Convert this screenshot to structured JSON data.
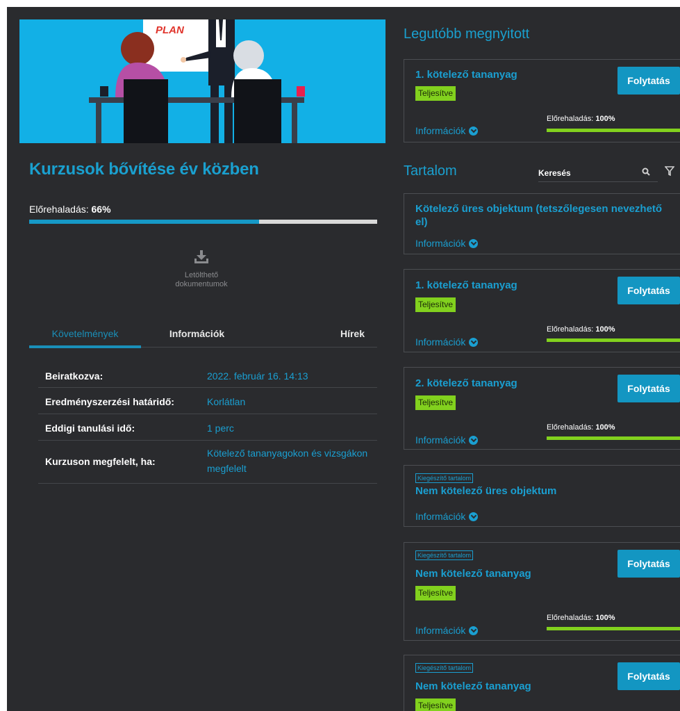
{
  "course": {
    "title": "Kurzusok bővítése év közben",
    "progress_label": "Előrehaladás:",
    "progress_value": "66%",
    "progress_fraction": 0.66,
    "banner_sign_text": "PLAN"
  },
  "downloads": {
    "label_line1": "Letölthető",
    "label_line2": "dokumentumok",
    "icon": "download-icon"
  },
  "tabs": [
    {
      "label": "Követelmények",
      "active": true
    },
    {
      "label": "Információk",
      "active": false
    },
    {
      "label": "Hírek",
      "active": false
    }
  ],
  "requirements": [
    {
      "label": "Beiratkozva:",
      "value": "2022. február 16. 14:13"
    },
    {
      "label": "Eredményszerzési határidő:",
      "value": "Korlátlan"
    },
    {
      "label": "Eddigi tanulási idő:",
      "value": "1 perc"
    },
    {
      "label": "Kurzuson megfelelt, ha:",
      "value": "Kötelező tananyagokon és vizsgákon megfelelt"
    }
  ],
  "recent": {
    "heading": "Legutóbb megnyitott",
    "card": {
      "title": "1. kötelező tananyag",
      "status": "Teljesítve",
      "button": "Folytatás",
      "progress_label": "Előrehaladás:",
      "progress_value": "100%",
      "info": "Információk"
    }
  },
  "content": {
    "heading": "Tartalom",
    "search_placeholder": "Keresés",
    "items": [
      {
        "title": "Kötelező üres objektum (tetszőlegesen nevezhető el)",
        "info": "Információk"
      },
      {
        "title": "1. kötelező tananyag",
        "status": "Teljesítve",
        "button": "Folytatás",
        "progress_label": "Előrehaladás:",
        "progress_value": "100%",
        "info": "Információk"
      },
      {
        "title": "2. kötelező tananyag",
        "status": "Teljesítve",
        "button": "Folytatás",
        "progress_label": "Előrehaladás:",
        "progress_value": "100%",
        "info": "Információk"
      },
      {
        "tag": "Kiegészítő tartalom",
        "title": "Nem kötelező üres objektum",
        "info": "Információk"
      },
      {
        "tag": "Kiegészítő tartalom",
        "title": "Nem kötelező tananyag",
        "status": "Teljesítve",
        "button": "Folytatás",
        "progress_label": "Előrehaladás:",
        "progress_value": "100%",
        "info": "Információk"
      },
      {
        "tag": "Kiegészítő tartalom",
        "title": "Nem kötelező tananyag",
        "status": "Teljesítve",
        "button": "Folytatás"
      }
    ]
  },
  "colors": {
    "accent": "#1a9fd1",
    "background": "#2a2b2e",
    "success": "#82d11e",
    "button": "#1396c2"
  }
}
